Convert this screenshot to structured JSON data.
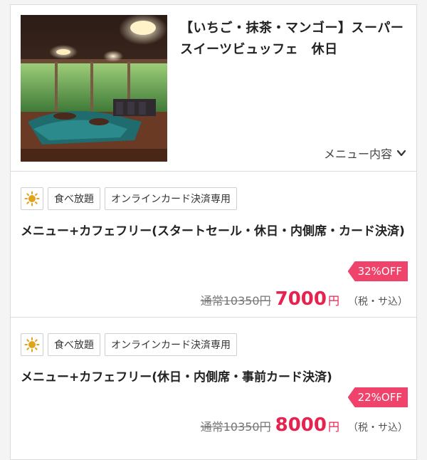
{
  "header": {
    "title": "【いちご・抹茶・マンゴー】スーパースイーツビュッフェ　休日",
    "menu_link": "メニュー内容"
  },
  "plans": [
    {
      "tags": [
        "食べ放題",
        "オンラインカード決済専用"
      ],
      "title": "メニュー+カフェフリー(スタートセール・休日・内側席・カード決済)",
      "discount": "32%OFF",
      "regular_price": "通常10350円",
      "price": "7000",
      "yen": "円",
      "tax_note": "（税・サ込）"
    },
    {
      "tags": [
        "食べ放題",
        "オンラインカード決済専用"
      ],
      "title": "メニュー+カフェフリー(休日・内側席・事前カード決済)",
      "discount": "22%OFF",
      "regular_price": "通常10350円",
      "price": "8000",
      "yen": "円",
      "tax_note": "（税・サ込）"
    }
  ],
  "colors": {
    "accent": "#e8224f",
    "badge": "#f0436b",
    "sun": "#e2a21a"
  }
}
